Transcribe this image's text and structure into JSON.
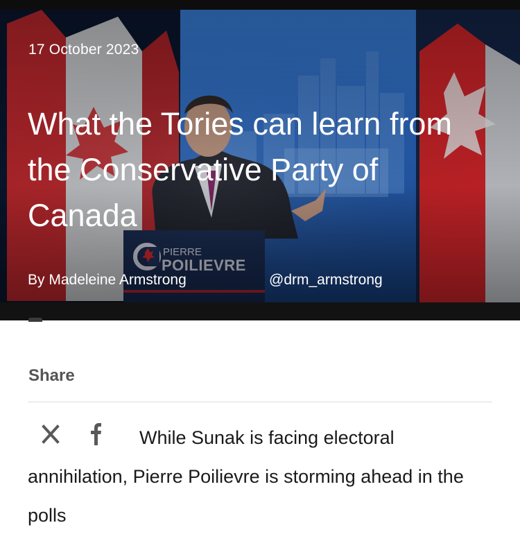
{
  "article": {
    "date": "17 October 2023",
    "title": "What the Tories can learn from the Conservative Party of Canada",
    "byline_author": "By Madeleine Armstrong",
    "byline_handle": "@drm_armstrong",
    "podium_sign": {
      "line1": "PIERRE",
      "line2": "POILIEVRE"
    }
  },
  "share": {
    "label": "Share",
    "icons": [
      "x-icon",
      "facebook-icon"
    ]
  },
  "standfirst": "While Sunak is facing electoral annihilation, Pierre Poilievre is storming ahead in the polls",
  "colors": {
    "hero_overlay": "#06101f",
    "flag_red": "#d8262b",
    "screen_blue": "#2f6fd1",
    "podium_navy": "#1b2f5a",
    "share_label": "#555555",
    "body_text": "#1a1a1a"
  }
}
